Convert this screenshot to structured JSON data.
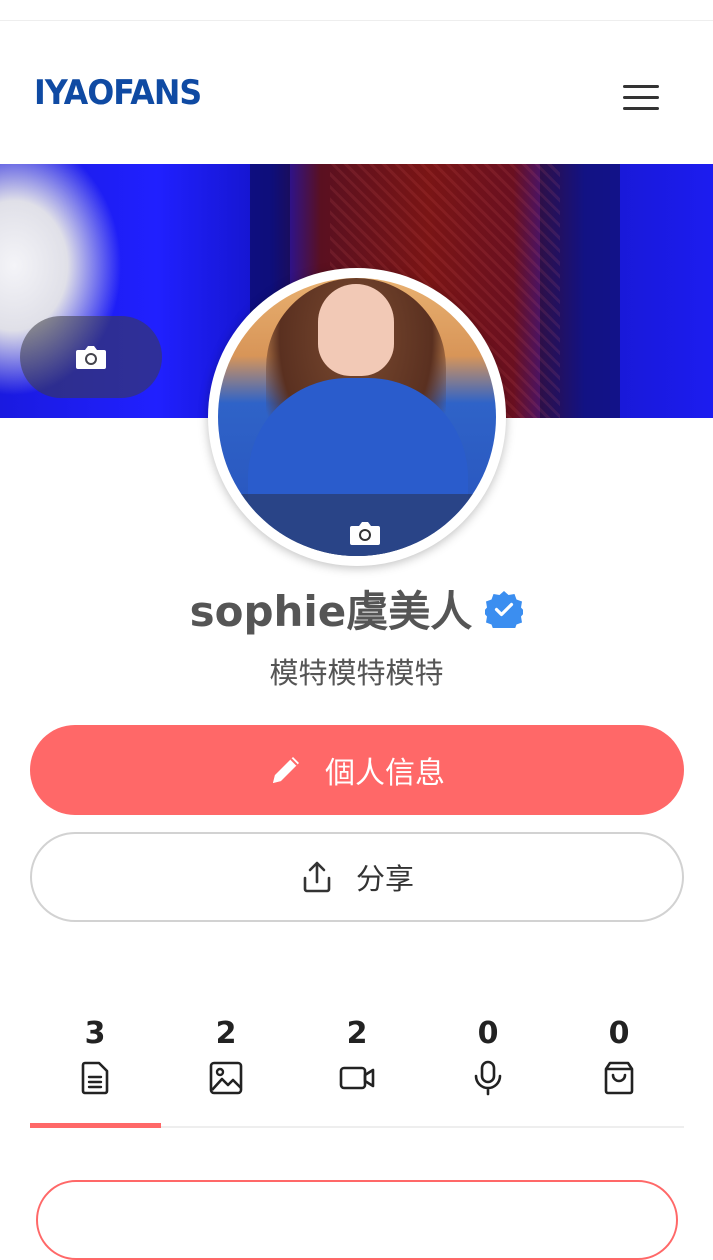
{
  "header": {
    "logo": "IYAOFANS",
    "menu_icon": "hamburger-menu-icon"
  },
  "cover": {
    "camera_icon": "camera-icon"
  },
  "avatar": {
    "camera_icon": "camera-icon"
  },
  "profile": {
    "name": "sophie虞美人",
    "verified_icon": "verified-badge-icon",
    "bio": "模特模特模特"
  },
  "actions": {
    "edit_label": "個人信息",
    "edit_icon": "pencil-icon",
    "share_label": "分享",
    "share_icon": "share-icon"
  },
  "stats": [
    {
      "count": "3",
      "icon": "document-icon"
    },
    {
      "count": "2",
      "icon": "image-icon"
    },
    {
      "count": "2",
      "icon": "video-icon"
    },
    {
      "count": "0",
      "icon": "microphone-icon"
    },
    {
      "count": "0",
      "icon": "shopping-bag-icon"
    }
  ],
  "colors": {
    "accent": "#ff6868",
    "logo": "#0f4aa3",
    "verified": "#3b8ef0"
  }
}
